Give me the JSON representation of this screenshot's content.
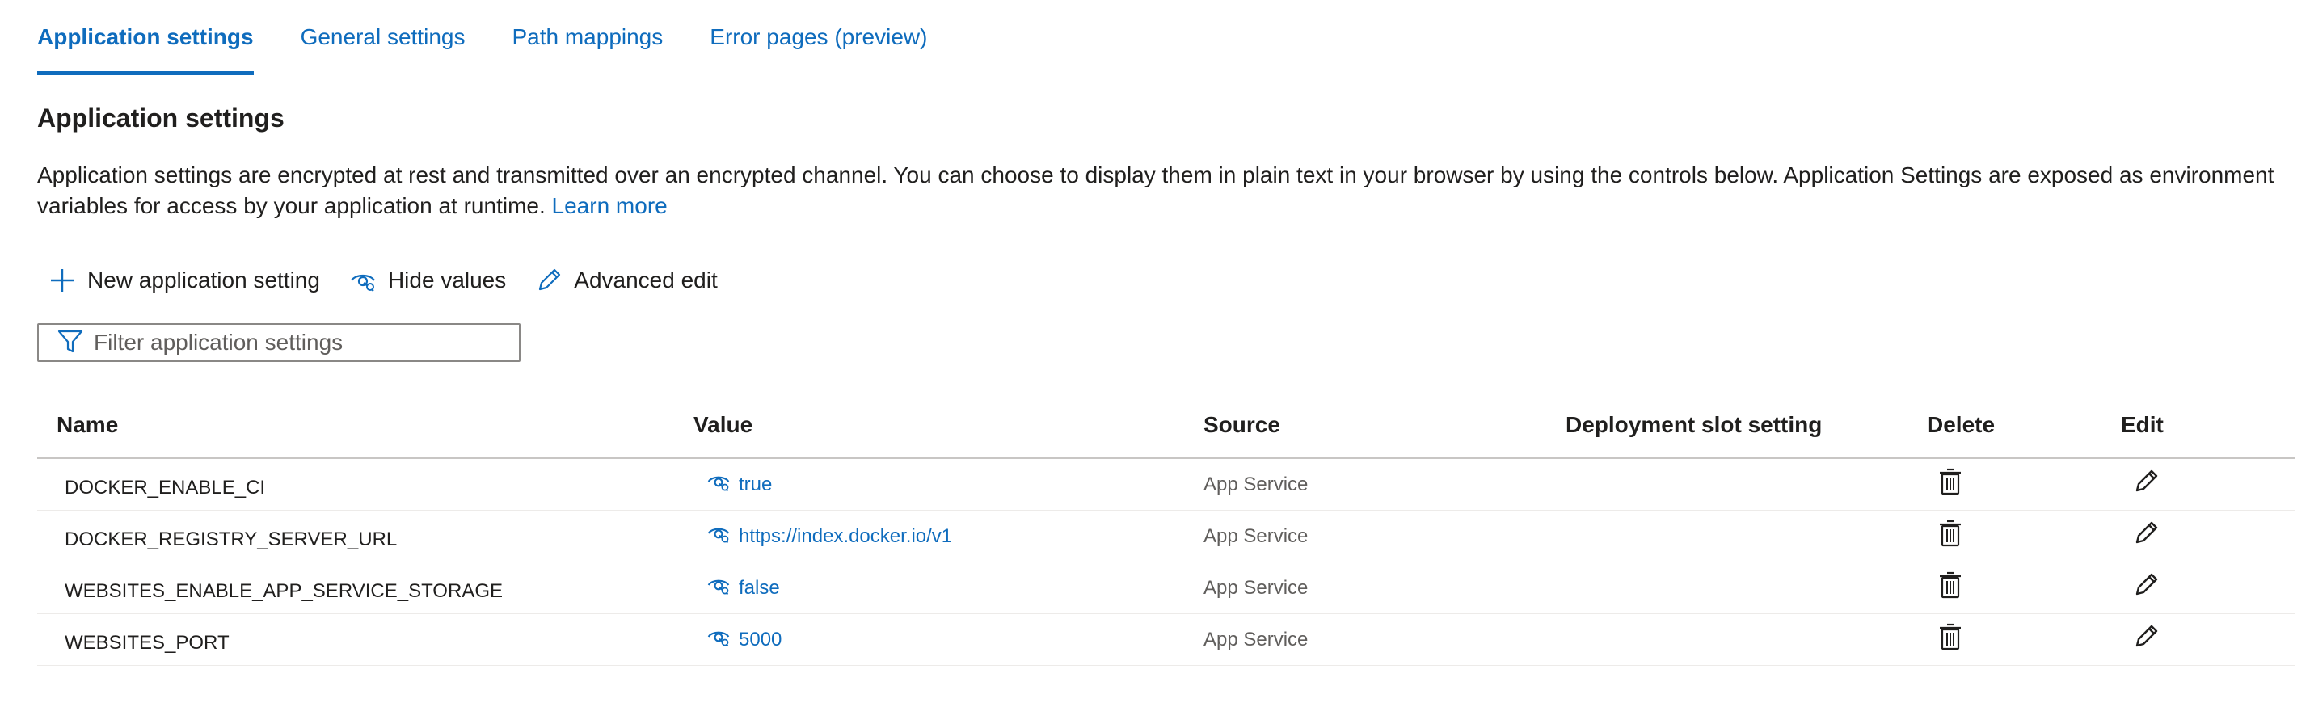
{
  "tabs": [
    {
      "label": "Application settings",
      "active": true
    },
    {
      "label": "General settings",
      "active": false
    },
    {
      "label": "Path mappings",
      "active": false
    },
    {
      "label": "Error pages (preview)",
      "active": false
    }
  ],
  "section": {
    "title": "Application settings",
    "description": "Application settings are encrypted at rest and transmitted over an encrypted channel. You can choose to display them in plain text in your browser by using the controls below. Application Settings are exposed as environment variables for access by your application at runtime.",
    "learn_more": "Learn more"
  },
  "commands": {
    "new_setting": "New application setting",
    "hide_values": "Hide values",
    "advanced_edit": "Advanced edit"
  },
  "filter": {
    "placeholder": "Filter application settings",
    "value": ""
  },
  "table": {
    "headers": {
      "name": "Name",
      "value": "Value",
      "source": "Source",
      "slot": "Deployment slot setting",
      "delete": "Delete",
      "edit": "Edit"
    },
    "rows": [
      {
        "name": "DOCKER_ENABLE_CI",
        "value": "true",
        "source": "App Service"
      },
      {
        "name": "DOCKER_REGISTRY_SERVER_URL",
        "value": "https://index.docker.io/v1",
        "source": "App Service"
      },
      {
        "name": "WEBSITES_ENABLE_APP_SERVICE_STORAGE",
        "value": "false",
        "source": "App Service"
      },
      {
        "name": "WEBSITES_PORT",
        "value": "5000",
        "source": "App Service"
      }
    ]
  },
  "colors": {
    "accent": "#0f6cbd",
    "text": "#201f1e",
    "muted": "#605e5c",
    "border": "#8a8886",
    "row_divider": "#edebe9"
  }
}
